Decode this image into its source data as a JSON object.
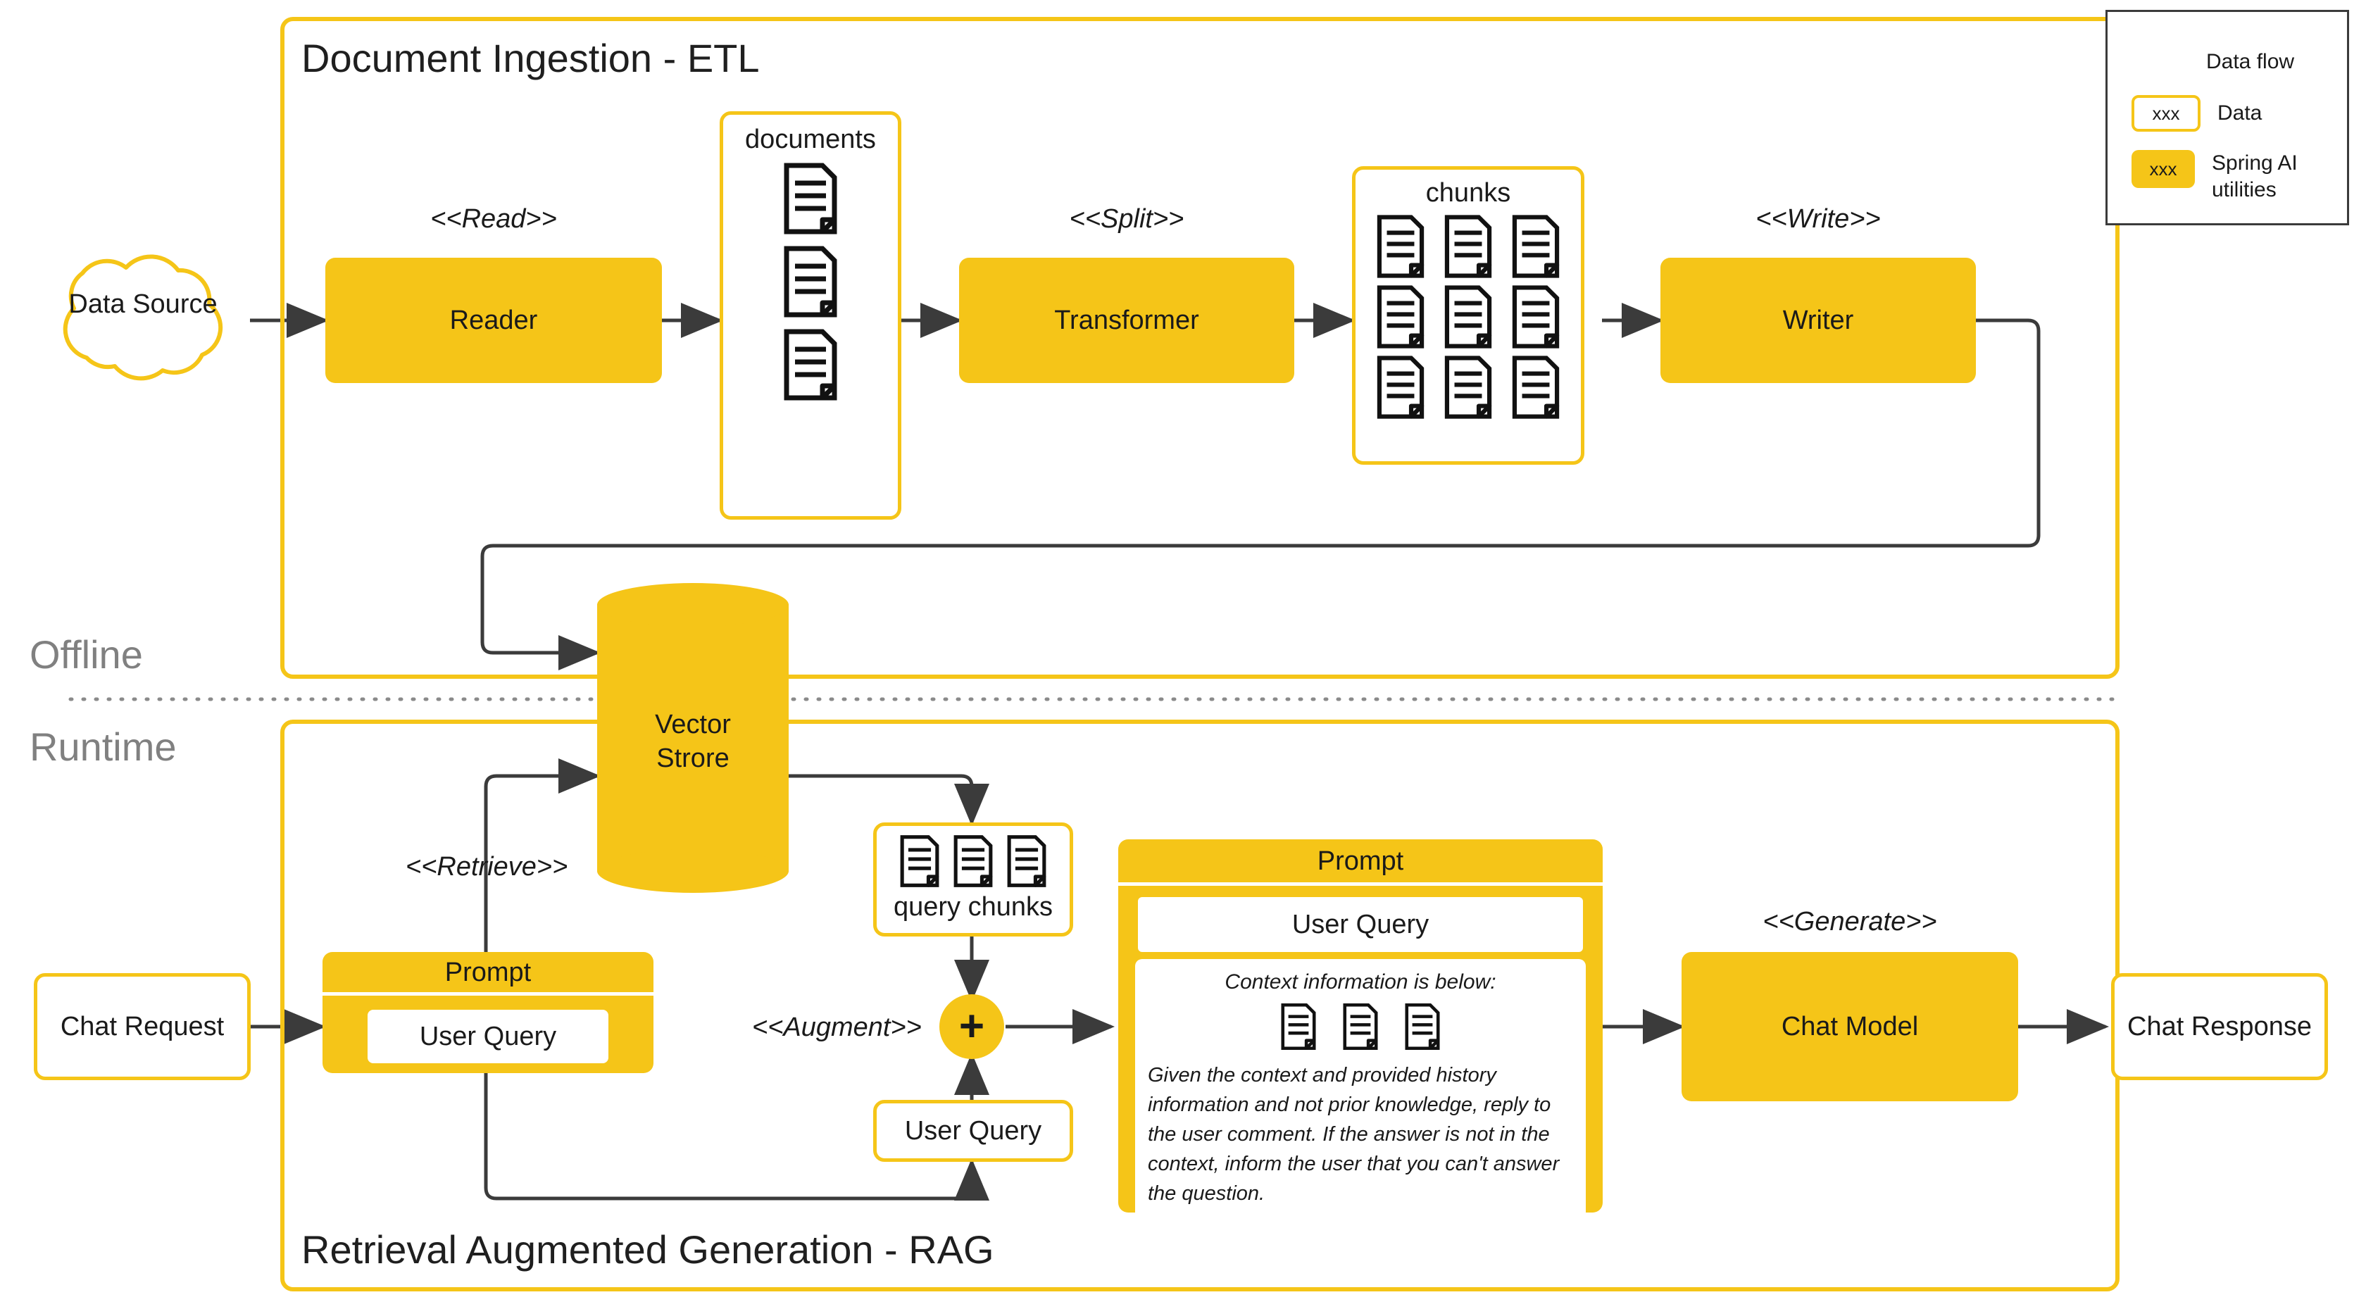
{
  "colors": {
    "accent": "#F5C518",
    "arrow": "#3b3b3b",
    "phase_label": "#808080",
    "text": "#1a1a1a",
    "background": "#ffffff"
  },
  "phases": {
    "offline_label": "Offline",
    "runtime_label": "Runtime"
  },
  "ingestion": {
    "title": "Document Ingestion - ETL",
    "source": "Data Source",
    "stereotype_read": "<<Read>>",
    "reader": "Reader",
    "documents_caption": "documents",
    "documents_count": 3,
    "stereotype_split": "<<Split>>",
    "transformer": "Transformer",
    "chunks_caption": "chunks",
    "chunks_count": 9,
    "stereotype_write": "<<Write>>",
    "writer": "Writer"
  },
  "vector_store": {
    "label_line1": "Vector",
    "label_line2": "Strore"
  },
  "rag": {
    "title": "Retrieval Augmented Generation - RAG",
    "chat_request": "Chat Request",
    "stereotype_retrieve": "<<Retrieve>>",
    "request_prompt": {
      "header": "Prompt",
      "user_query": "User Query"
    },
    "query_chunks": {
      "caption": "query chunks",
      "count": 3
    },
    "stereotype_augment": "<<Augment>>",
    "plus_symbol": "+",
    "user_query_box": "User Query",
    "augmented_prompt": {
      "header": "Prompt",
      "user_query": "User Query",
      "context_header": "Context information is below:",
      "context_docs_count": 3,
      "instruction": "Given the context and provided history information and not prior knowledge, reply to the user comment. If the answer is not in the context, inform the user that you can't answer the question."
    },
    "stereotype_generate": "<<Generate>>",
    "chat_model": "Chat Model",
    "chat_response": "Chat Response"
  },
  "legend": {
    "rows": [
      {
        "kind": "arrow",
        "swatch": "",
        "label": "Data flow"
      },
      {
        "kind": "data",
        "swatch": "xxx",
        "label": "Data"
      },
      {
        "kind": "util",
        "swatch": "xxx",
        "label": "Spring AI utilities"
      }
    ],
    "data_flow_label": "Data flow",
    "data_label": "Data",
    "spring_label_line1": "Spring AI",
    "spring_label_line2": "utilities",
    "swatch_text": "xxx"
  }
}
